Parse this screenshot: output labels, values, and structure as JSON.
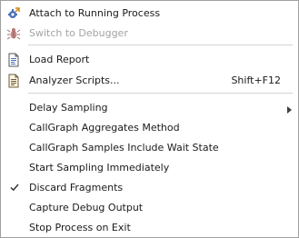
{
  "menu": {
    "items": [
      {
        "label": "Attach to Running Process",
        "icon": "attach-process-icon",
        "disabled": false
      },
      {
        "label": "Switch to Debugger",
        "icon": "debugger-bug-icon",
        "disabled": true
      },
      {
        "label": "Load Report",
        "icon": "report-document-icon",
        "disabled": false
      },
      {
        "label": "Analyzer Scripts...",
        "icon": "script-document-icon",
        "shortcut": "Shift+F12",
        "disabled": false
      },
      {
        "label": "Delay Sampling",
        "has_submenu": true,
        "disabled": false
      },
      {
        "label": "CallGraph Aggregates Method",
        "disabled": false
      },
      {
        "label": "CallGraph Samples Include Wait State",
        "disabled": false
      },
      {
        "label": "Start Sampling Immediately",
        "disabled": false
      },
      {
        "label": "Discard Fragments",
        "checked": true,
        "disabled": false
      },
      {
        "label": "Capture Debug Output",
        "disabled": false
      },
      {
        "label": "Stop Process on Exit",
        "disabled": false
      }
    ]
  },
  "colors": {
    "text": "#1a1a1a",
    "disabled_text": "#a3a3a3",
    "separator": "#d4d4d4",
    "border": "#a0a0a0"
  }
}
